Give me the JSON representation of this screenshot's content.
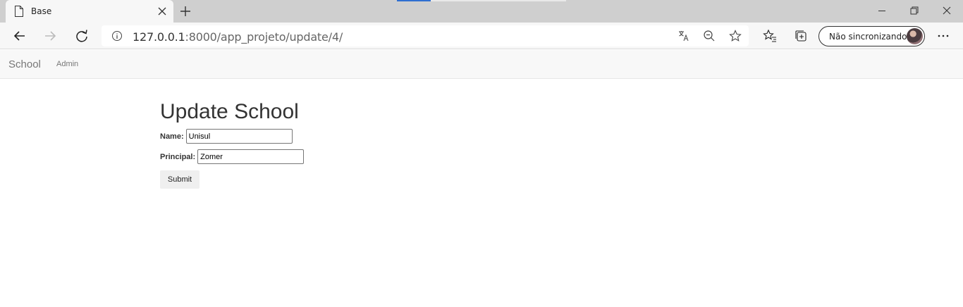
{
  "browser": {
    "tab_title": "Base",
    "url_host": "127.0.0.1",
    "url_rest": ":8000/app_projeto/update/4/",
    "profile_label": "Não sincronizando",
    "icons": [
      "page-icon",
      "close-icon",
      "plus-icon",
      "back-icon",
      "forward-icon",
      "refresh-icon",
      "info-icon",
      "translate-icon",
      "zoom-out-icon",
      "star-icon",
      "favorites-icon",
      "collections-icon",
      "more-icon"
    ]
  },
  "site": {
    "brand": "School",
    "nav_admin": "Admin"
  },
  "form": {
    "title": "Update School",
    "name_label": "Name:",
    "name_value": "Unisul",
    "principal_label": "Principal:",
    "principal_value": "Zomer",
    "submit_label": "Submit"
  }
}
